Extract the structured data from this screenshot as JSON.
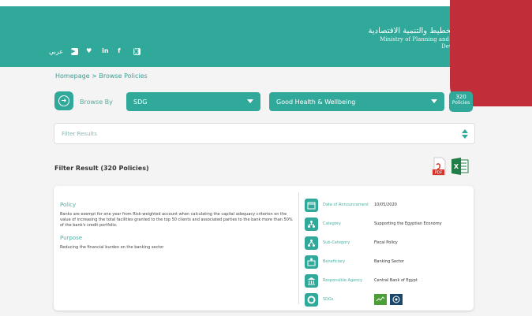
{
  "header": {
    "arabic_title": "وزارة التخطيط والتنمية الاقتصادية",
    "english_title_line1": "Ministry of Planning and Economic",
    "english_title_line2": "Development",
    "language_link": "عربي",
    "social_icons": [
      "youtube-icon",
      "twitter-icon",
      "linkedin-icon",
      "facebook-icon",
      "instagram-icon"
    ],
    "brand_color": "#30a89a",
    "accent_color": "#c12e3a"
  },
  "breadcrumb": "Homepage > Browse Policies",
  "browse": {
    "label": "Browse By",
    "select1_value": "SDG",
    "select2_value": "Good Health & Wellbeing",
    "count_number": "320",
    "count_label": "Policies"
  },
  "filter": {
    "placeholder": "Filter Results"
  },
  "results": {
    "title": "Filter Result (320 Policies)"
  },
  "card": {
    "policy_title": "Policy",
    "policy_text": "Banks are exempt for one year from Risk-weighted account when calculating the capital adequacy criterion on the value of increasing the total facilities granted to the top 50 clients and associated parties to the bank more than 50% of the bank's credit portfolio.",
    "purpose_title": "Purpose",
    "purpose_text": "Reducing the financial burden on the banking sector",
    "details": [
      {
        "label": "Date of Announcement",
        "value": "10/05/2020",
        "icon": "calendar-icon"
      },
      {
        "label": "Category",
        "value": "Supporting the Egyptian Economy",
        "icon": "category-icon"
      },
      {
        "label": "Sub-Category",
        "value": "Fiscal Policy",
        "icon": "subcategory-icon"
      },
      {
        "label": "Beneficiary",
        "value": "Banking Sector",
        "icon": "beneficiary-icon"
      },
      {
        "label": "Responsible Agency",
        "value": "Central Bank of Egypt",
        "icon": "agency-icon"
      },
      {
        "label": "SDGs",
        "value": "",
        "icon": "sdg-icon"
      }
    ]
  }
}
